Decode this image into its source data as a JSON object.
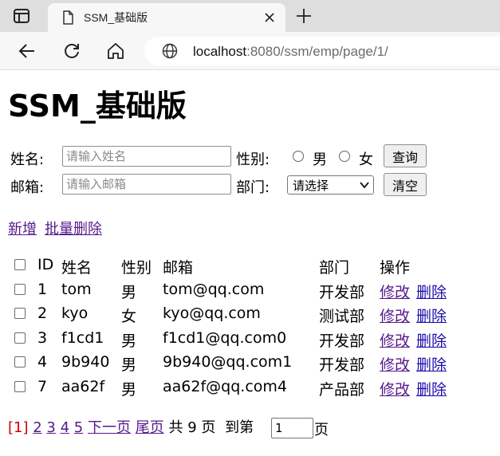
{
  "browser": {
    "tab_title": "SSM_基础版",
    "url_host": "localhost",
    "url_rest": ":8080/ssm/emp/page/1/"
  },
  "page": {
    "title": "SSM_基础版"
  },
  "search": {
    "name_label": "姓名:",
    "name_placeholder": "请输入姓名",
    "gender_label": "性别:",
    "male": "男",
    "female": "女",
    "query_button": "查询",
    "email_label": "邮箱:",
    "email_placeholder": "请输入邮箱",
    "dept_label": "部门:",
    "dept_selected": "请选择",
    "clear_button": "清空"
  },
  "actions": {
    "add": "新增",
    "batch_delete": "批量删除"
  },
  "table": {
    "headers": {
      "id": "ID",
      "name": "姓名",
      "gender": "性别",
      "email": "邮箱",
      "dept": "部门",
      "ops": "操作"
    },
    "edit_label": "修改",
    "delete_label": "删除",
    "rows": [
      {
        "id": "1",
        "name": "tom",
        "gender": "男",
        "email": "tom@qq.com",
        "dept": "开发部"
      },
      {
        "id": "2",
        "name": "kyo",
        "gender": "女",
        "email": "kyo@qq.com",
        "dept": "测试部"
      },
      {
        "id": "3",
        "name": "f1cd1",
        "gender": "男",
        "email": "f1cd1@qq.com0",
        "dept": "开发部"
      },
      {
        "id": "4",
        "name": "9b940",
        "gender": "男",
        "email": "9b940@qq.com1",
        "dept": "开发部"
      },
      {
        "id": "7",
        "name": "aa62f",
        "gender": "男",
        "email": "aa62f@qq.com4",
        "dept": "产品部"
      }
    ]
  },
  "pagination": {
    "current": "[1]",
    "pages": [
      "2",
      "3",
      "4",
      "5"
    ],
    "next": "下一页",
    "last": "尾页",
    "total_prefix": "共",
    "total": "9",
    "total_suffix": "页",
    "goto_prefix": "到第",
    "goto_value": "1",
    "goto_suffix": "页"
  }
}
